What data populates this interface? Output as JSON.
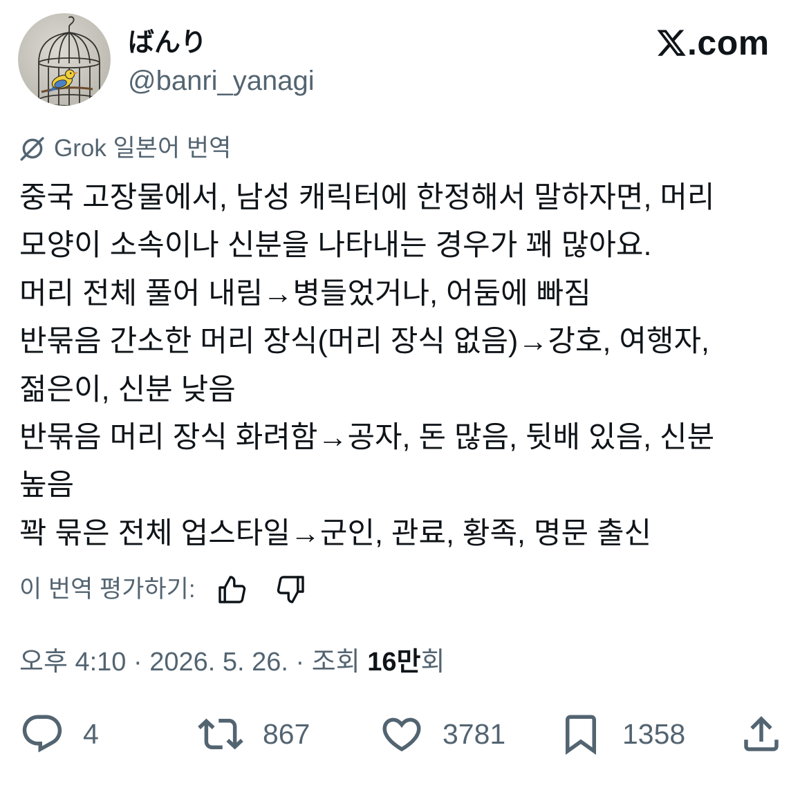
{
  "colors": {
    "text": "#0f1419",
    "secondary": "#536471",
    "background": "#ffffff"
  },
  "header": {
    "display_name": "ばんり",
    "handle": "@banri_yanagi",
    "logo": {
      "icon": "x-logo-icon",
      "text": ".com"
    }
  },
  "translation": {
    "icon": "grok-icon",
    "label": "Grok 일본어 번역"
  },
  "tweet": {
    "lines": [
      "중국 고장물에서, 남성 캐릭터에 한정해서 말하자면, 머리",
      "모양이 소속이나 신분을 나타내는 경우가 꽤 많아요.",
      "머리 전체 풀어 내림→병들었거나, 어둠에 빠짐",
      "반묶음 간소한 머리 장식(머리 장식 없음)→강호, 여행자,",
      "젊은이, 신분 낮음",
      "반묶음 머리 장식 화려함→공자, 돈 많음, 뒷배 있음, 신분",
      "높음",
      "꽉 묶은 전체 업스타일→군인, 관료, 황족, 명문 출신"
    ]
  },
  "rating": {
    "label": "이 번역 평가하기:",
    "up_icon": "thumbs-up-icon",
    "down_icon": "thumbs-down-icon"
  },
  "meta": {
    "time": "오후 4:10",
    "separator": "·",
    "date": "2026. 5. 26.",
    "views_label": "조회",
    "views_count": "16만",
    "views_suffix": "회"
  },
  "actions": {
    "reply": {
      "icon": "reply-icon",
      "count": "4"
    },
    "repost": {
      "icon": "repost-icon",
      "count": "867"
    },
    "like": {
      "icon": "heart-icon",
      "count": "3781"
    },
    "bookmark": {
      "icon": "bookmark-icon",
      "count": "1358"
    },
    "share": {
      "icon": "share-icon"
    }
  }
}
